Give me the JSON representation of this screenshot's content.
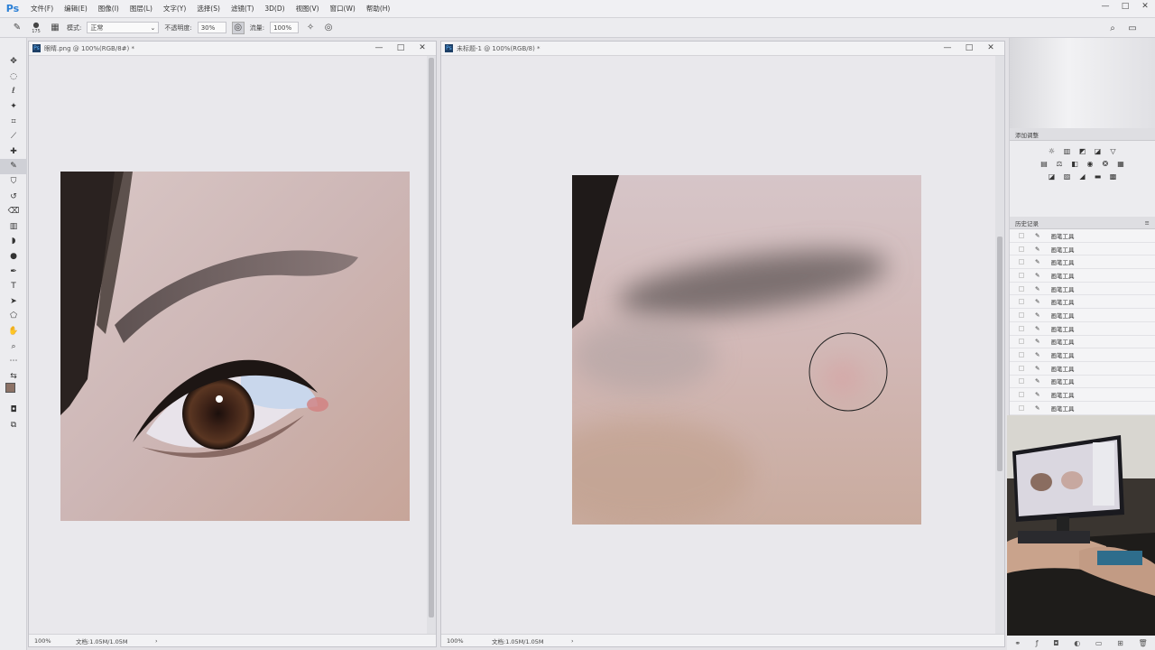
{
  "app": {
    "logo": "Ps"
  },
  "menu": [
    "文件(F)",
    "编辑(E)",
    "图像(I)",
    "图层(L)",
    "文字(Y)",
    "选择(S)",
    "滤镜(T)",
    "3D(D)",
    "视图(V)",
    "窗口(W)",
    "帮助(H)"
  ],
  "window_controls": {
    "minimize": "—",
    "maximize": "□",
    "close": "✕"
  },
  "options": {
    "brush_size": "175",
    "mode_label": "模式:",
    "mode_value": "正常",
    "opacity_label": "不透明度:",
    "opacity_value": "30%",
    "flow_label": "流量:",
    "flow_value": "100%"
  },
  "tools": [
    "move",
    "marquee",
    "lasso",
    "magic-wand",
    "crop",
    "eyedropper",
    "healing",
    "brush",
    "stamp",
    "history-brush",
    "eraser",
    "gradient",
    "blur",
    "dodge",
    "pen",
    "type",
    "path-select",
    "shape",
    "hand",
    "zoom",
    "more",
    "colors"
  ],
  "docs": [
    {
      "title": "眼睛.png @ 100%(RGB/8#) *",
      "zoom": "100%",
      "status": "文档:1.05M/1.05M",
      "arrow": "›"
    },
    {
      "title": "未标题-1 @ 100%(RGB/8) *",
      "zoom": "100%",
      "status": "文档:1.05M/1.05M",
      "arrow": "›"
    }
  ],
  "panels": {
    "adjust_title": "添加调整",
    "history_title": "历史记录",
    "history_items": [
      "画笔工具",
      "画笔工具",
      "画笔工具",
      "画笔工具",
      "画笔工具",
      "画笔工具",
      "画笔工具",
      "画笔工具",
      "画笔工具",
      "画笔工具",
      "画笔工具",
      "画笔工具",
      "画笔工具",
      "画笔工具"
    ]
  },
  "colors": {
    "accent": "#2a7fd6",
    "foreground": "#8c7266",
    "background": "#ffffff"
  }
}
